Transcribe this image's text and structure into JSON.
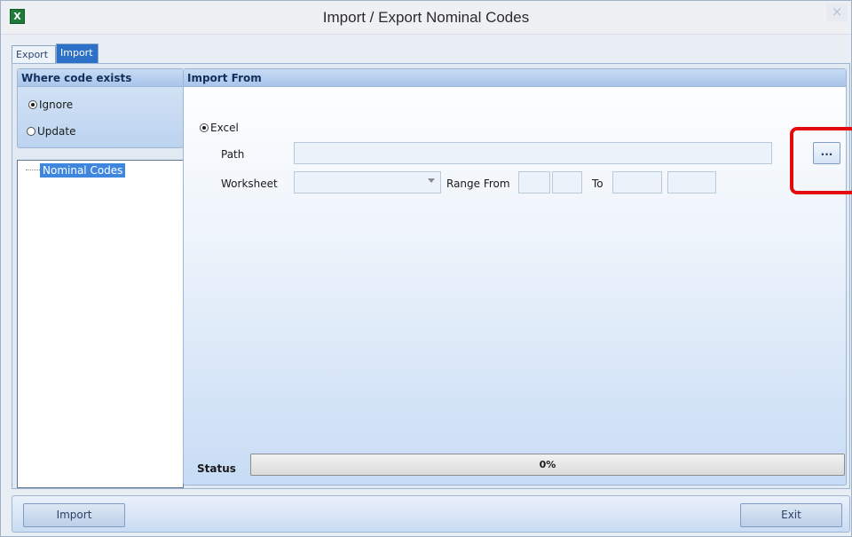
{
  "window": {
    "title": "Import / Export Nominal Codes",
    "close_symbol": "×",
    "app_icon_glyph": "X"
  },
  "tabs": [
    {
      "label": "Export",
      "active": false
    },
    {
      "label": "Import",
      "active": true
    }
  ],
  "where_code_exists": {
    "title": "Where code exists",
    "options": [
      {
        "label": "Ignore",
        "selected": true
      },
      {
        "label": "Update",
        "selected": false
      }
    ]
  },
  "tree": {
    "items": [
      {
        "label": "Nominal Codes",
        "selected": true
      }
    ]
  },
  "import_from": {
    "title": "Import From",
    "source_label": "Excel",
    "source_selected": true,
    "path_label": "Path",
    "path_value": "",
    "browse_label": "...",
    "worksheet_label": "Worksheet",
    "worksheet_value": "",
    "range_from_label": "Range From",
    "to_label": "To"
  },
  "status": {
    "label": "Status",
    "progress_text": "0%",
    "progress_fraction": 0
  },
  "buttons": {
    "import_label": "Import",
    "exit_label": "Exit"
  },
  "colors": {
    "accent": "#2d70c8",
    "highlight": "#e30b0b",
    "selection": "#3f86df"
  }
}
